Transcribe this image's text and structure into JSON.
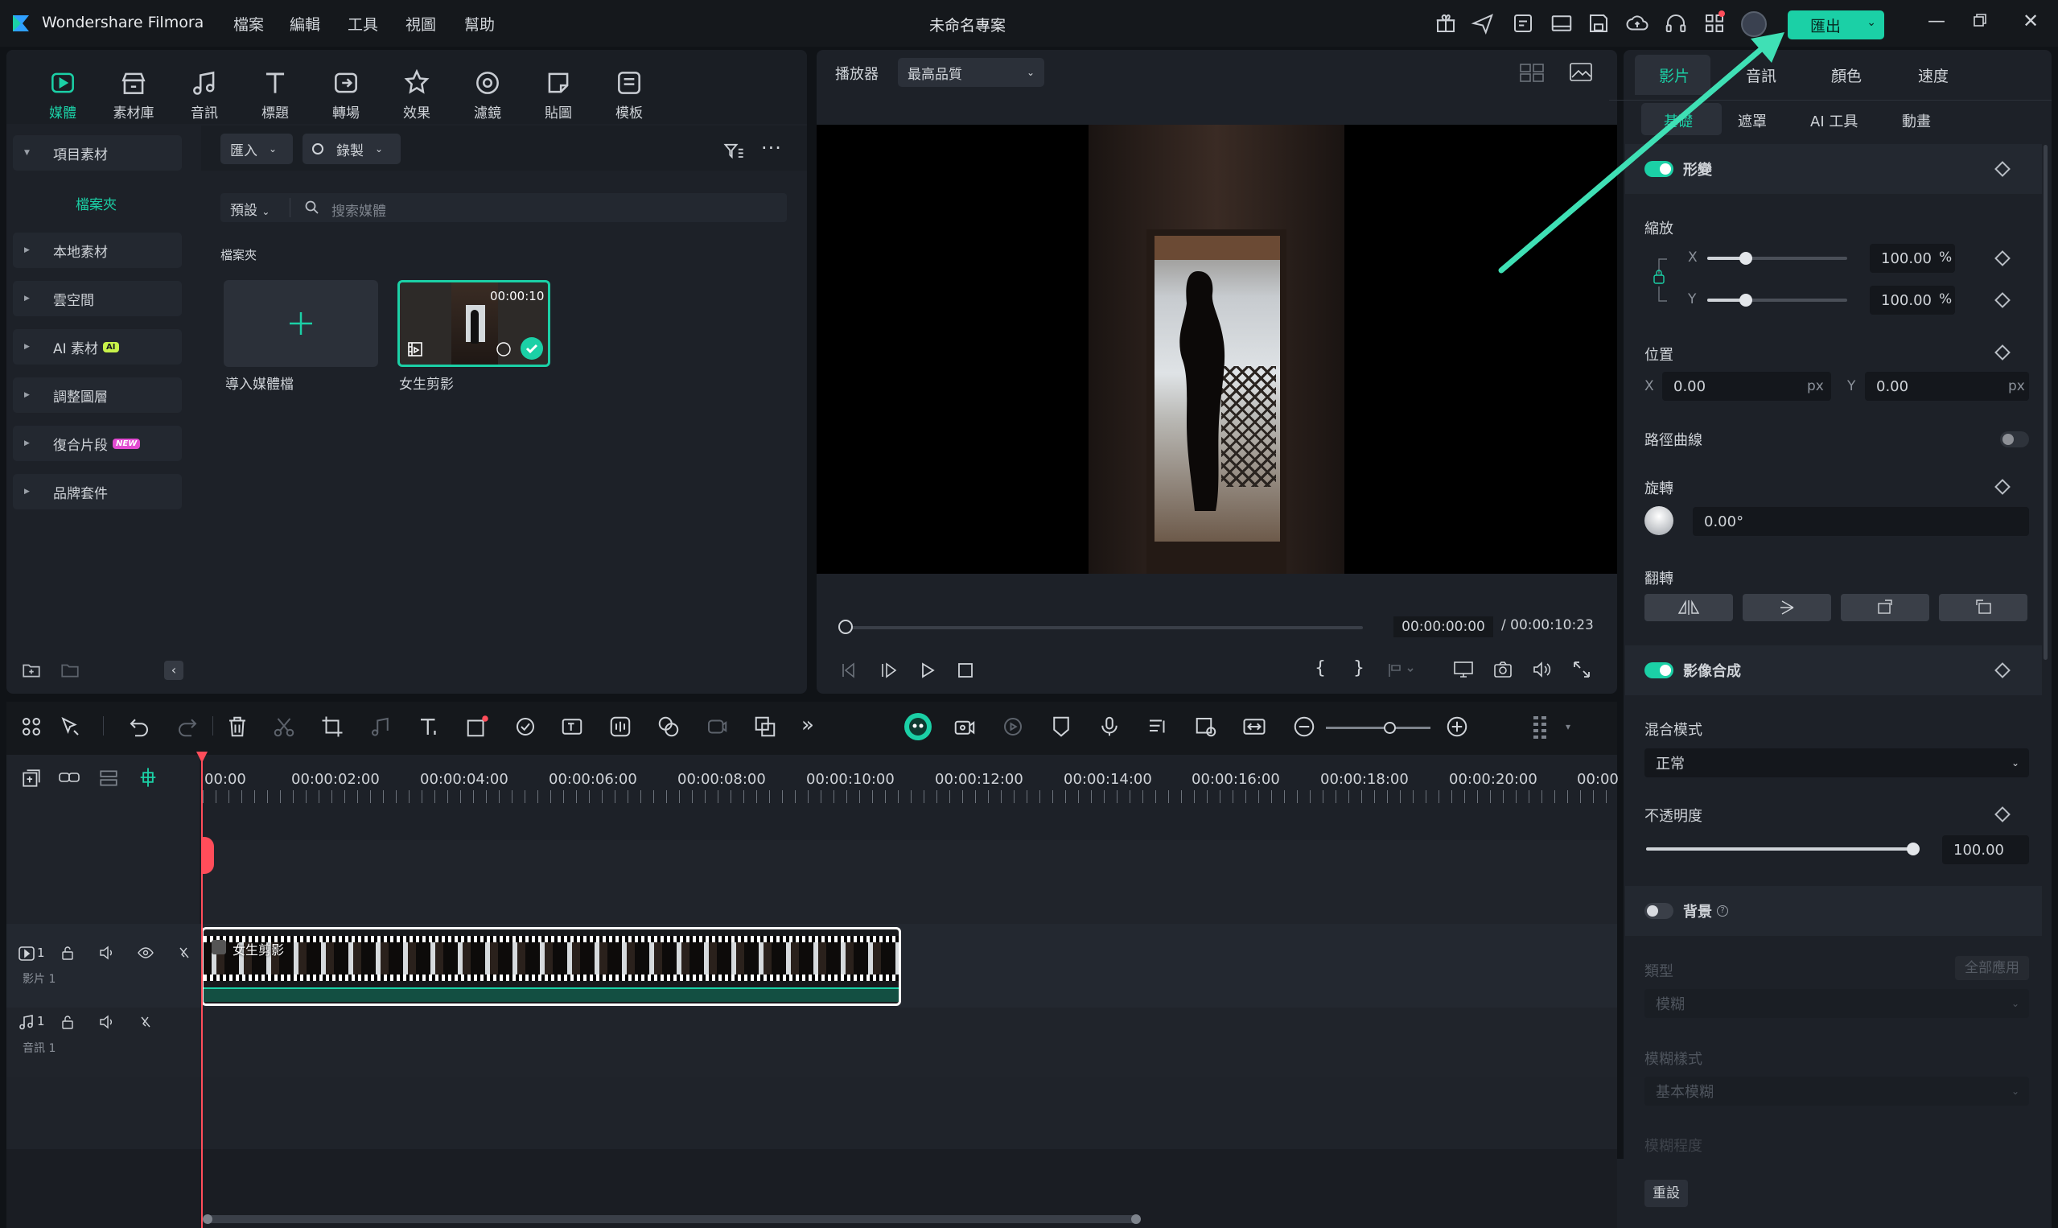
{
  "app": {
    "name": "Wondershare Filmora",
    "project_title": "未命名專案",
    "export_label": "匯出"
  },
  "menu": [
    "檔案",
    "編輯",
    "工具",
    "視圖",
    "幫助"
  ],
  "library": {
    "tabs": [
      {
        "label": "媒體",
        "icon": "media-icon"
      },
      {
        "label": "素材庫",
        "icon": "stock-icon"
      },
      {
        "label": "音訊",
        "icon": "audio-icon"
      },
      {
        "label": "標題",
        "icon": "title-icon"
      },
      {
        "label": "轉場",
        "icon": "transition-icon"
      },
      {
        "label": "效果",
        "icon": "effects-icon"
      },
      {
        "label": "濾鏡",
        "icon": "filter-icon"
      },
      {
        "label": "貼圖",
        "icon": "sticker-icon"
      },
      {
        "label": "模板",
        "icon": "template-icon"
      }
    ],
    "sidebar": {
      "project_media": "項目素材",
      "folder": "檔案夾",
      "items": [
        "本地素材",
        "雲空間",
        "AI 素材",
        "調整圖層",
        "復合片段",
        "品牌套件"
      ],
      "ai_badge": "AI",
      "new_badge": "NEW"
    },
    "import_label": "匯入",
    "record_label": "錄製",
    "preset_label": "預設",
    "search_placeholder": "搜索媒體",
    "folder_heading": "檔案夾",
    "import_tile_label": "導入媒體檔",
    "clip": {
      "name": "女生剪影",
      "duration": "00:00:10"
    }
  },
  "player": {
    "label": "播放器",
    "quality": "最高品質",
    "current_time": "00:00:00:00",
    "total_time": "/ 00:00:10:23"
  },
  "properties": {
    "tabs": [
      "影片",
      "音訊",
      "顏色",
      "速度"
    ],
    "subtabs": [
      "基礎",
      "遮罩",
      "AI 工具",
      "動畫"
    ],
    "transform": "形變",
    "scale": "縮放",
    "scale_x": "100.00",
    "scale_y": "100.00",
    "percent": "%",
    "position": "位置",
    "pos_x": "0.00",
    "pos_y": "0.00",
    "px": "px",
    "path_curve": "路徑曲線",
    "rotation": "旋轉",
    "rotation_value": "0.00°",
    "flip": "翻轉",
    "compositing": "影像合成",
    "blend_mode_label": "混合模式",
    "blend_mode": "正常",
    "opacity_label": "不透明度",
    "opacity_value": "100.00",
    "background": "背景",
    "type_label": "類型",
    "apply_all": "全部應用",
    "type_value": "模糊",
    "blur_style_label": "模糊樣式",
    "blur_style_value": "基本模糊",
    "blur_level_label": "模糊程度",
    "reset": "重設",
    "x": "X",
    "y": "Y"
  },
  "timeline": {
    "ruler": [
      "00:00",
      "00:00:02:00",
      "00:00:04:00",
      "00:00:06:00",
      "00:00:08:00",
      "00:00:10:00",
      "00:00:12:00",
      "00:00:14:00",
      "00:00:16:00",
      "00:00:18:00",
      "00:00:20:00",
      "00:00"
    ],
    "video_track_num": "1",
    "video_track_label": "影片 1",
    "audio_track_num": "1",
    "audio_track_label": "音訊 1",
    "clip_label": "女生剪影"
  },
  "colors": {
    "accent": "#1bd0a6",
    "arrow": "#3fe0b5",
    "playhead": "#ff4d5a"
  }
}
